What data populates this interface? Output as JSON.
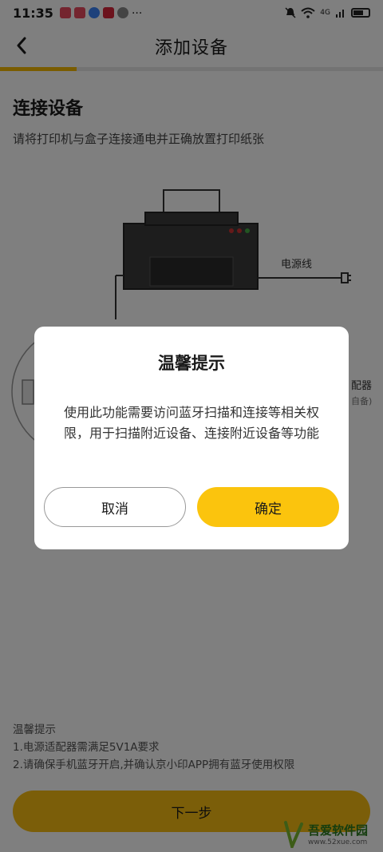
{
  "status_bar": {
    "time": "11:35",
    "more": "···",
    "network": "4G"
  },
  "header": {
    "title": "添加设备",
    "progress_fraction": 0.2
  },
  "main": {
    "section_title": "连接设备",
    "section_desc": "请将打印机与盒子连接通电并正确放置打印纸张",
    "power_cable_label": "电源线",
    "adapter_label": "配器",
    "adapter_sub": "自备)",
    "tips_title": "温馨提示",
    "tip_1": "1.电源适配器需满足5V1A要求",
    "tip_2": "2.请确保手机蓝牙开启,并确认京小印APP拥有蓝牙使用权限",
    "next_button": "下一步"
  },
  "dialog": {
    "title": "温馨提示",
    "body": "使用此功能需要访问蓝牙扫描和连接等相关权限，用于扫描附近设备、连接附近设备等功能",
    "cancel_label": "取消",
    "confirm_label": "确定"
  },
  "watermark": {
    "text": "吾爱软件园",
    "url": "www.52xue.com"
  },
  "colors": {
    "accent": "#f7bd12",
    "overlay": "rgba(0,0,0,0.5)"
  }
}
